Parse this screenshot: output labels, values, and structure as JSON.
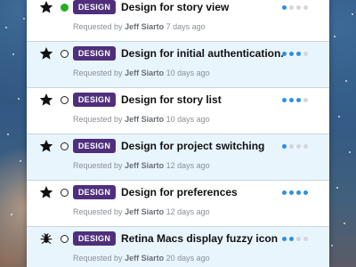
{
  "stories": [
    {
      "starred": true,
      "icon": "star-icon",
      "completed": true,
      "label": "DESIGN",
      "title": "Design for story view",
      "requested_prefix": "Requested by",
      "author": "Jeff Siarto",
      "age": "7 days ago",
      "points": 1,
      "points_max": 4
    },
    {
      "starred": true,
      "icon": "star-icon",
      "completed": false,
      "label": "DESIGN",
      "title": "Design for initial authentication...",
      "requested_prefix": "Requested by",
      "author": "Jeff Siarto",
      "age": "10 days ago",
      "points": 3,
      "points_max": 4
    },
    {
      "starred": true,
      "icon": "star-icon",
      "completed": false,
      "label": "DESIGN",
      "title": "Design for story list",
      "requested_prefix": "Requested by",
      "author": "Jeff Siarto",
      "age": "10 days ago",
      "points": 3,
      "points_max": 4
    },
    {
      "starred": true,
      "icon": "star-icon",
      "completed": false,
      "label": "DESIGN",
      "title": "Design for project switching",
      "requested_prefix": "Requested by",
      "author": "Jeff Siarto",
      "age": "12 days ago",
      "points": 1,
      "points_max": 4
    },
    {
      "starred": true,
      "icon": "star-icon",
      "completed": false,
      "label": "DESIGN",
      "title": "Design for preferences",
      "requested_prefix": "Requested by",
      "author": "Jeff Siarto",
      "age": "12 days ago",
      "points": 4,
      "points_max": 4
    },
    {
      "starred": false,
      "icon": "bug-icon",
      "completed": false,
      "label": "DESIGN",
      "title": "Retina Macs display fuzzy icon",
      "requested_prefix": "Requested by",
      "author": "Jeff Siarto",
      "age": "20 days ago",
      "points": 2,
      "points_max": 4
    }
  ],
  "colors": {
    "badge_bg": "#4f2f7c",
    "status_done": "#22b020",
    "pip_on": "#2e8fe0",
    "pip_off": "#d3d6d9",
    "row_white": "#ffffff",
    "row_blue": "#e8f5fd"
  }
}
